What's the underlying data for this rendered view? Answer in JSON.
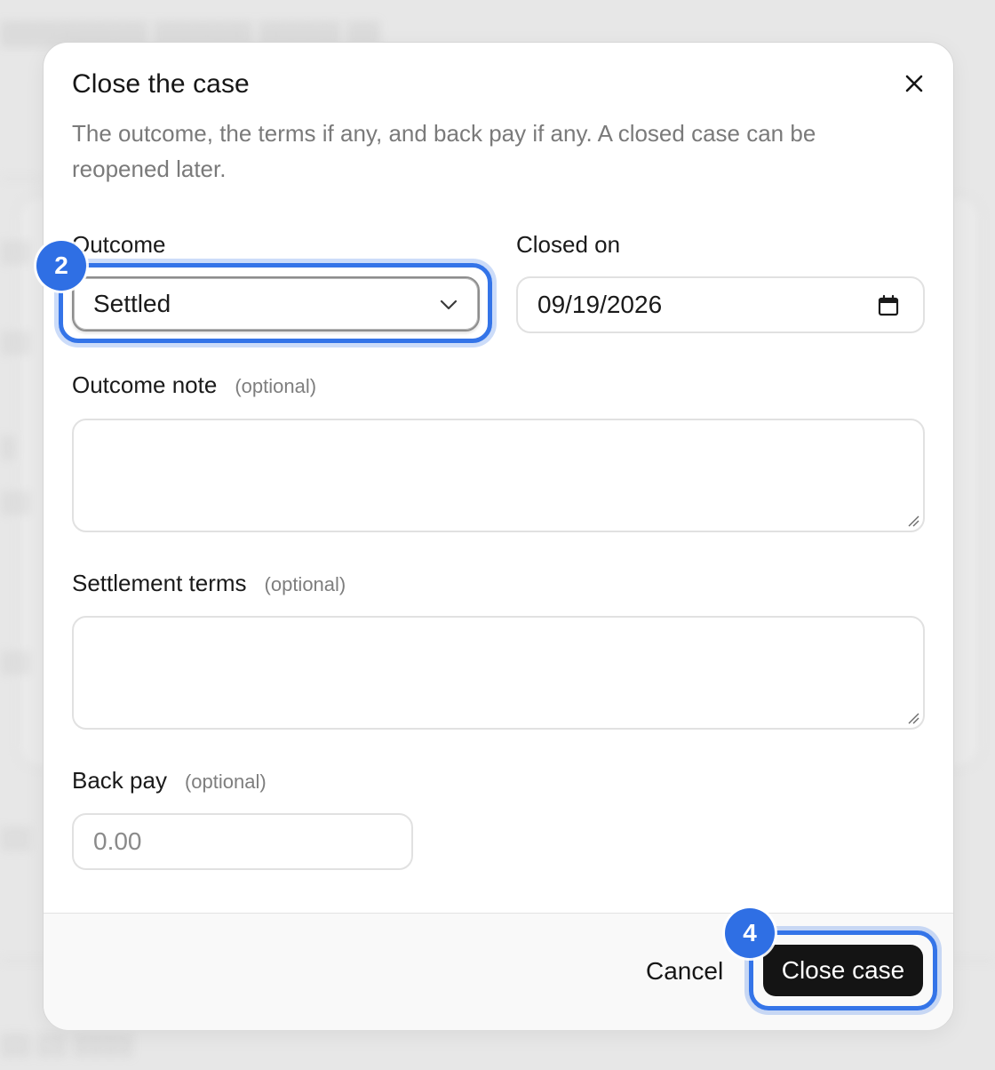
{
  "dialog": {
    "title": "Close the case",
    "description": "The outcome, the terms if any, and back pay if any. A closed case can be reopened later."
  },
  "form": {
    "outcome": {
      "label": "Outcome",
      "value": "Settled"
    },
    "closed_on": {
      "label": "Closed on",
      "value": "09/19/2026"
    },
    "outcome_note": {
      "label": "Outcome note",
      "hint": "(optional)",
      "value": ""
    },
    "settlement_terms": {
      "label": "Settlement terms",
      "hint": "(optional)",
      "value": ""
    },
    "back_pay": {
      "label": "Back pay",
      "hint": "(optional)",
      "placeholder": "0.00"
    }
  },
  "actions": {
    "cancel_label": "Cancel",
    "submit_label": "Close case"
  },
  "annotations": {
    "outcome_marker": "2",
    "submit_marker": "4"
  },
  "colors": {
    "accent": "#3474e8",
    "primary_button": "#141414",
    "backdrop": "#e7e7e7"
  },
  "icons": {
    "close": "close-icon",
    "select": "chevron-down-icon",
    "date": "calendar-icon"
  }
}
